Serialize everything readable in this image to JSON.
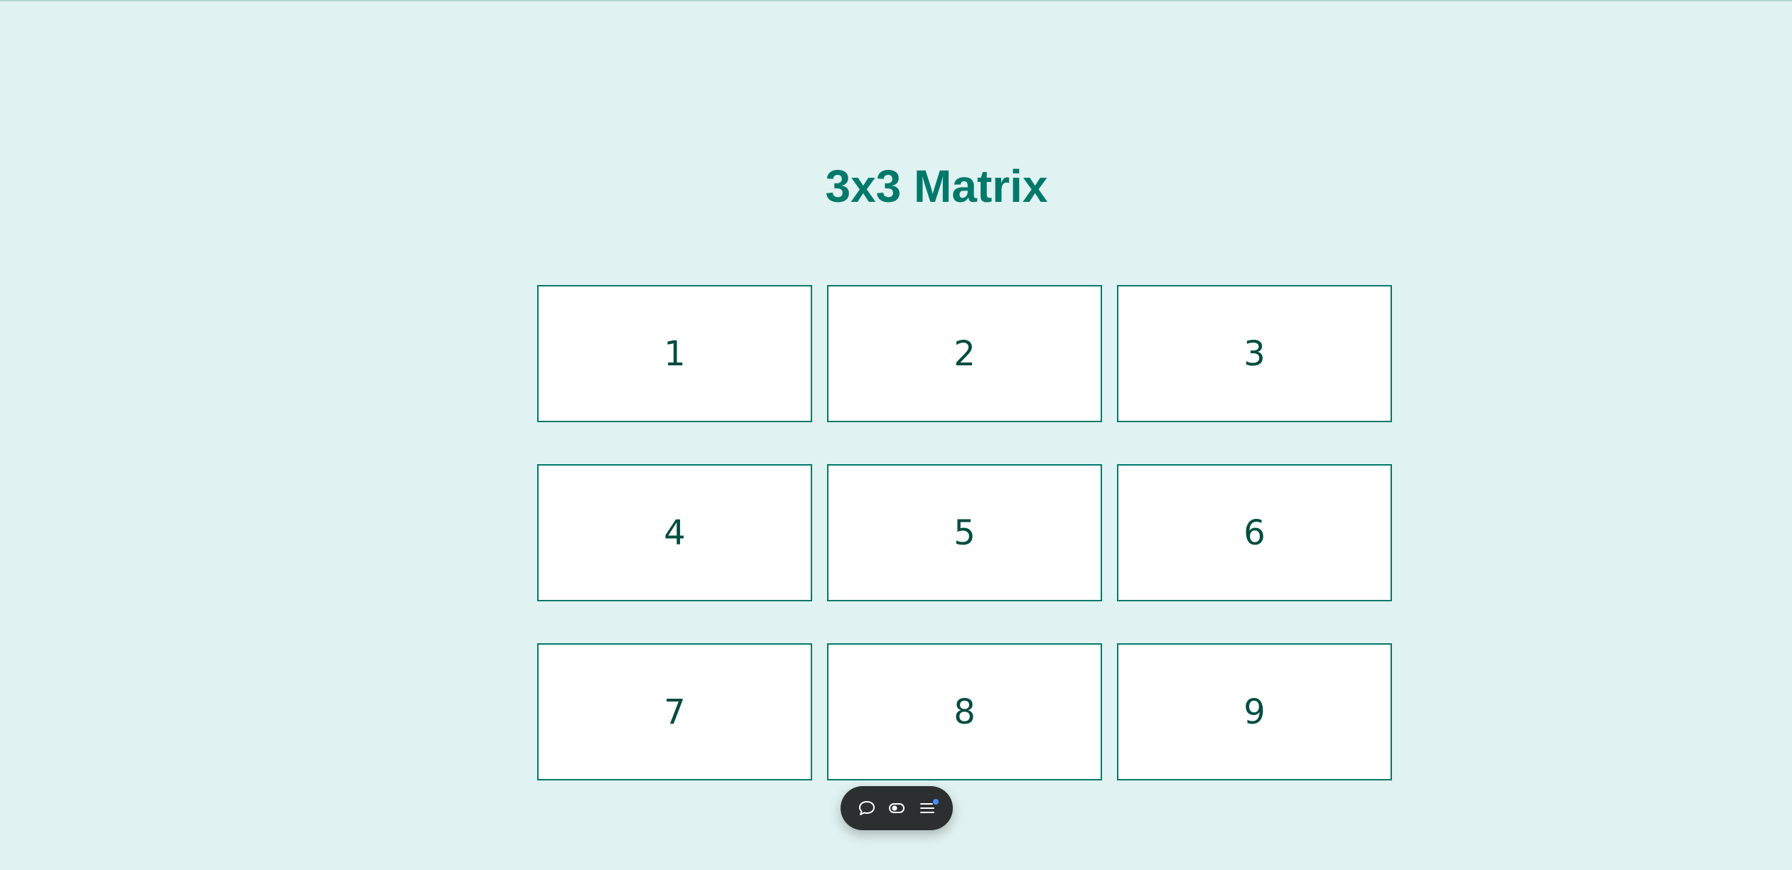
{
  "page": {
    "title": "3x3 Matrix"
  },
  "matrix": {
    "cells": [
      "1",
      "2",
      "3",
      "4",
      "5",
      "6",
      "7",
      "8",
      "9"
    ]
  },
  "toolbar": {
    "buttons": [
      {
        "icon": "chat-bubble-icon"
      },
      {
        "icon": "eye-toggle-icon"
      },
      {
        "icon": "menu-icon",
        "has_notification_dot": true
      }
    ],
    "notification_color": "#4a8cff"
  },
  "colors": {
    "background": "#e0f2f1",
    "accent": "#00796b",
    "cell_text": "#004d40",
    "cell_background": "#ffffff",
    "toolbar_background": "#2b2f2f"
  }
}
